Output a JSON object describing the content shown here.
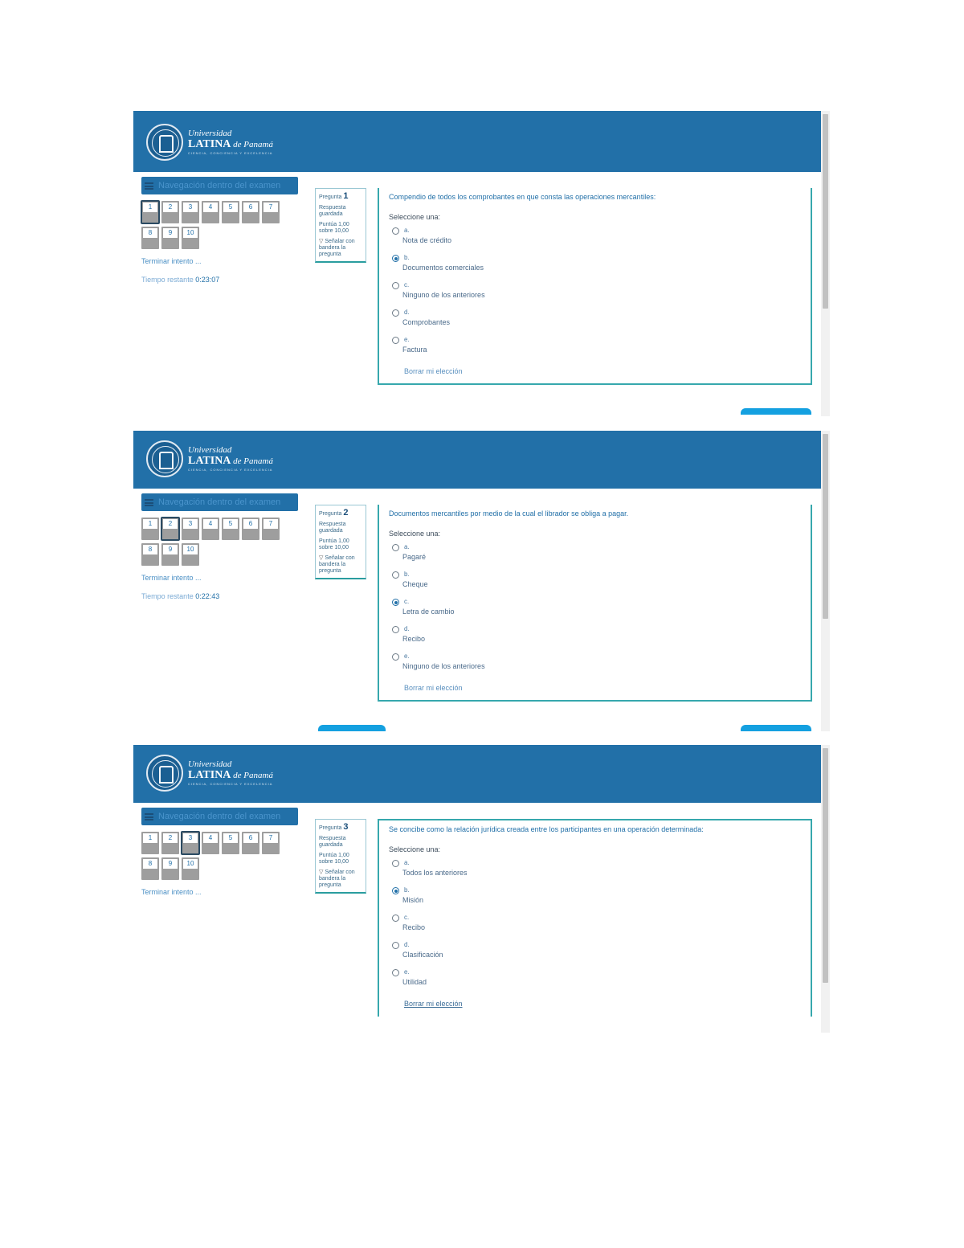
{
  "logo": {
    "line1": "Universidad",
    "line2_main": "LATINA",
    "line2_suffix": "de Panamá",
    "tagline": "CIENCIA, CONCIENCIA Y EXCELENCIA"
  },
  "nav": {
    "title": "Navegación dentro del examen",
    "numbers": [
      "1",
      "2",
      "3",
      "4",
      "5",
      "6",
      "7",
      "8",
      "9",
      "10"
    ],
    "finish_label": "Terminar intento ...",
    "time_label": "Tiempo restante"
  },
  "colors": {
    "header": "#2270a8",
    "accent": "#36a8ad",
    "button": "#14a0e0"
  },
  "screens": [
    {
      "current": 1,
      "time_left": "0:23:07",
      "question": {
        "label": "Pregunta",
        "number": "1",
        "status": "Respuesta guardada",
        "grade": "Puntúa 1,00 sobre 10,00",
        "flag": "Señalar con bandera la pregunta",
        "text": "Compendio de todos los comprobantes en que consta las operaciones mercantiles:",
        "select_label": "Seleccione una:",
        "options": [
          {
            "letter": "a.",
            "text": "Nota de crédito",
            "checked": false
          },
          {
            "letter": "b.",
            "text": "Documentos comerciales",
            "checked": true
          },
          {
            "letter": "c.",
            "text": "Ninguno de los anteriores",
            "checked": false
          },
          {
            "letter": "d.",
            "text": "Comprobantes",
            "checked": false
          },
          {
            "letter": "e.",
            "text": "Factura",
            "checked": false
          }
        ],
        "clear_label": "Borrar mi elección"
      }
    },
    {
      "current": 2,
      "time_left": "0:22:43",
      "question": {
        "label": "Pregunta",
        "number": "2",
        "status": "Respuesta guardada",
        "grade": "Puntúa 1,00 sobre 10,00",
        "flag": "Señalar con bandera la pregunta",
        "text": "Documentos mercantiles por medio de la cual el librador se obliga a pagar.",
        "select_label": "Seleccione una:",
        "options": [
          {
            "letter": "a.",
            "text": "Pagaré",
            "checked": false
          },
          {
            "letter": "b.",
            "text": "Cheque",
            "checked": false
          },
          {
            "letter": "c.",
            "text": "Letra de cambio",
            "checked": true
          },
          {
            "letter": "d.",
            "text": "Recibo",
            "checked": false
          },
          {
            "letter": "e.",
            "text": "Ninguno de los anteriores",
            "checked": false
          }
        ],
        "clear_label": "Borrar mi elección"
      }
    },
    {
      "current": 3,
      "question": {
        "label": "Pregunta",
        "number": "3",
        "status": "Respuesta guardada",
        "grade": "Puntúa 1,00 sobre 10,00",
        "flag": "Señalar con bandera la pregunta",
        "text": "Se concibe como la relación jurídica creada entre los participantes en una operación determinada:",
        "select_label": "Seleccione una:",
        "options": [
          {
            "letter": "a.",
            "text": "Todos los anteriores",
            "checked": false
          },
          {
            "letter": "b.",
            "text": "Misión",
            "checked": true
          },
          {
            "letter": "c.",
            "text": "Recibo",
            "checked": false
          },
          {
            "letter": "d.",
            "text": "Clasificación",
            "checked": false
          },
          {
            "letter": "e.",
            "text": "Utilidad",
            "checked": false
          }
        ],
        "clear_label": "Borrar mi elección"
      }
    }
  ]
}
